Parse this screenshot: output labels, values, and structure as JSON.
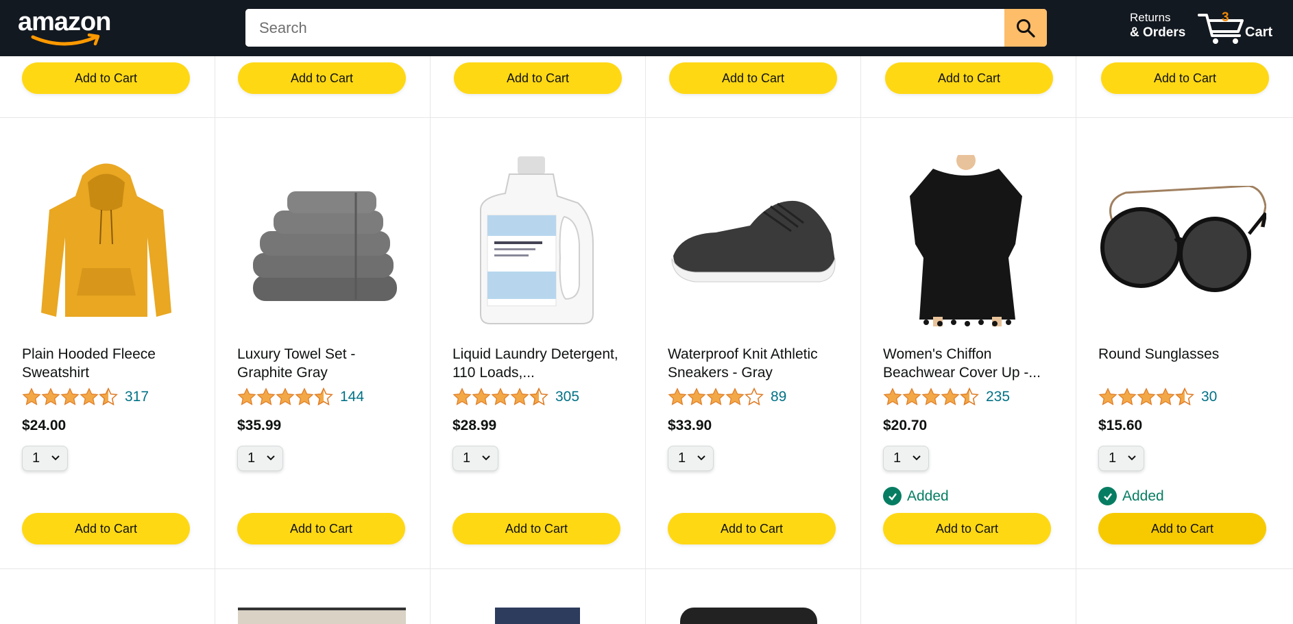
{
  "header": {
    "logo_text": "amazon",
    "search_placeholder": "Search",
    "returns_line1": "Returns",
    "returns_line2": "& Orders",
    "cart_count": "3",
    "cart_label": "Cart"
  },
  "top_row": {
    "button_label": "Add to Cart"
  },
  "products": [
    {
      "title": "Plain Hooded Fleece Sweatshirt",
      "rating": 4.5,
      "reviews": "317",
      "price": "$24.00",
      "qty": "1",
      "added": "",
      "button": "Add to Cart"
    },
    {
      "title": "Luxury Towel Set - Graphite Gray",
      "rating": 4.5,
      "reviews": "144",
      "price": "$35.99",
      "qty": "1",
      "added": "",
      "button": "Add to Cart"
    },
    {
      "title": "Liquid Laundry Detergent, 110 Loads,...",
      "rating": 4.5,
      "reviews": "305",
      "price": "$28.99",
      "qty": "1",
      "added": "",
      "button": "Add to Cart"
    },
    {
      "title": "Waterproof Knit Athletic Sneakers - Gray",
      "rating": 4.0,
      "reviews": "89",
      "price": "$33.90",
      "qty": "1",
      "added": "",
      "button": "Add to Cart"
    },
    {
      "title": "Women's Chiffon Beachwear Cover Up -...",
      "rating": 4.5,
      "reviews": "235",
      "price": "$20.70",
      "qty": "1",
      "added": "Added",
      "button": "Add to Cart"
    },
    {
      "title": "Round Sunglasses",
      "rating": 4.5,
      "reviews": "30",
      "price": "$15.60",
      "qty": "1",
      "added": "Added",
      "button": "Add to Cart"
    }
  ],
  "colors": {
    "header_bg": "#131921",
    "button": "#ffd814",
    "star": "#f3a847",
    "link": "#007185",
    "added": "#067d62"
  }
}
